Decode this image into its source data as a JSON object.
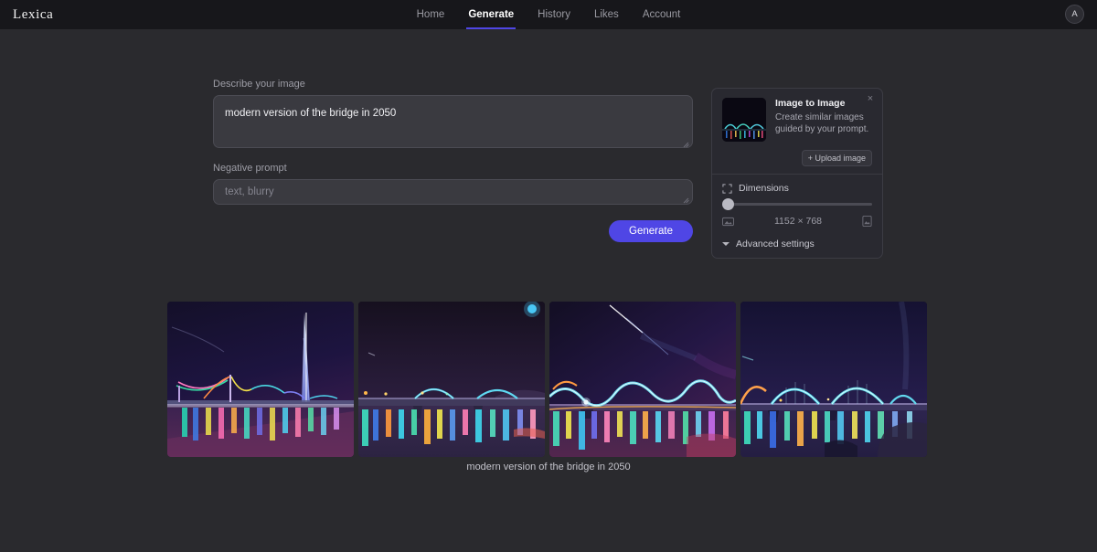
{
  "brand": {
    "logo": "Lexica"
  },
  "nav": {
    "items": [
      {
        "label": "Home",
        "active": false
      },
      {
        "label": "Generate",
        "active": true
      },
      {
        "label": "History",
        "active": false
      },
      {
        "label": "Likes",
        "active": false
      },
      {
        "label": "Account",
        "active": false
      }
    ],
    "avatar_initial": "A"
  },
  "composer": {
    "describe_label": "Describe your image",
    "describe_value": "modern version of the bridge in 2050",
    "describe_placeholder": "",
    "negative_label": "Negative prompt",
    "negative_value": "",
    "negative_placeholder": "text, blurry",
    "generate_label": "Generate"
  },
  "side_panel": {
    "close_label": "×",
    "image_to_image": {
      "title": "Image to Image",
      "description": "Create similar images guided by your prompt."
    },
    "upload_label": "+ Upload image",
    "dimensions": {
      "label": "Dimensions",
      "value": "1152 × 768",
      "slider_position_percent": 0
    },
    "advanced_settings_label": "Advanced settings"
  },
  "results": {
    "caption": "modern version of the bridge in 2050",
    "images": [
      {
        "alt": "neon cable-stayed bridge with tall glowing tower at night"
      },
      {
        "alt": "arched neon bridge at night with blue moon"
      },
      {
        "alt": "wavy neon light ribbon bridge with comet streak"
      },
      {
        "alt": "multi-arch cyan neon bridge over water"
      }
    ]
  },
  "colors": {
    "accent": "#4f46e5",
    "nav_bg": "#17171b",
    "page_bg": "#2a2a2e",
    "card_bg": "#292930",
    "input_bg": "#3a3a40"
  }
}
